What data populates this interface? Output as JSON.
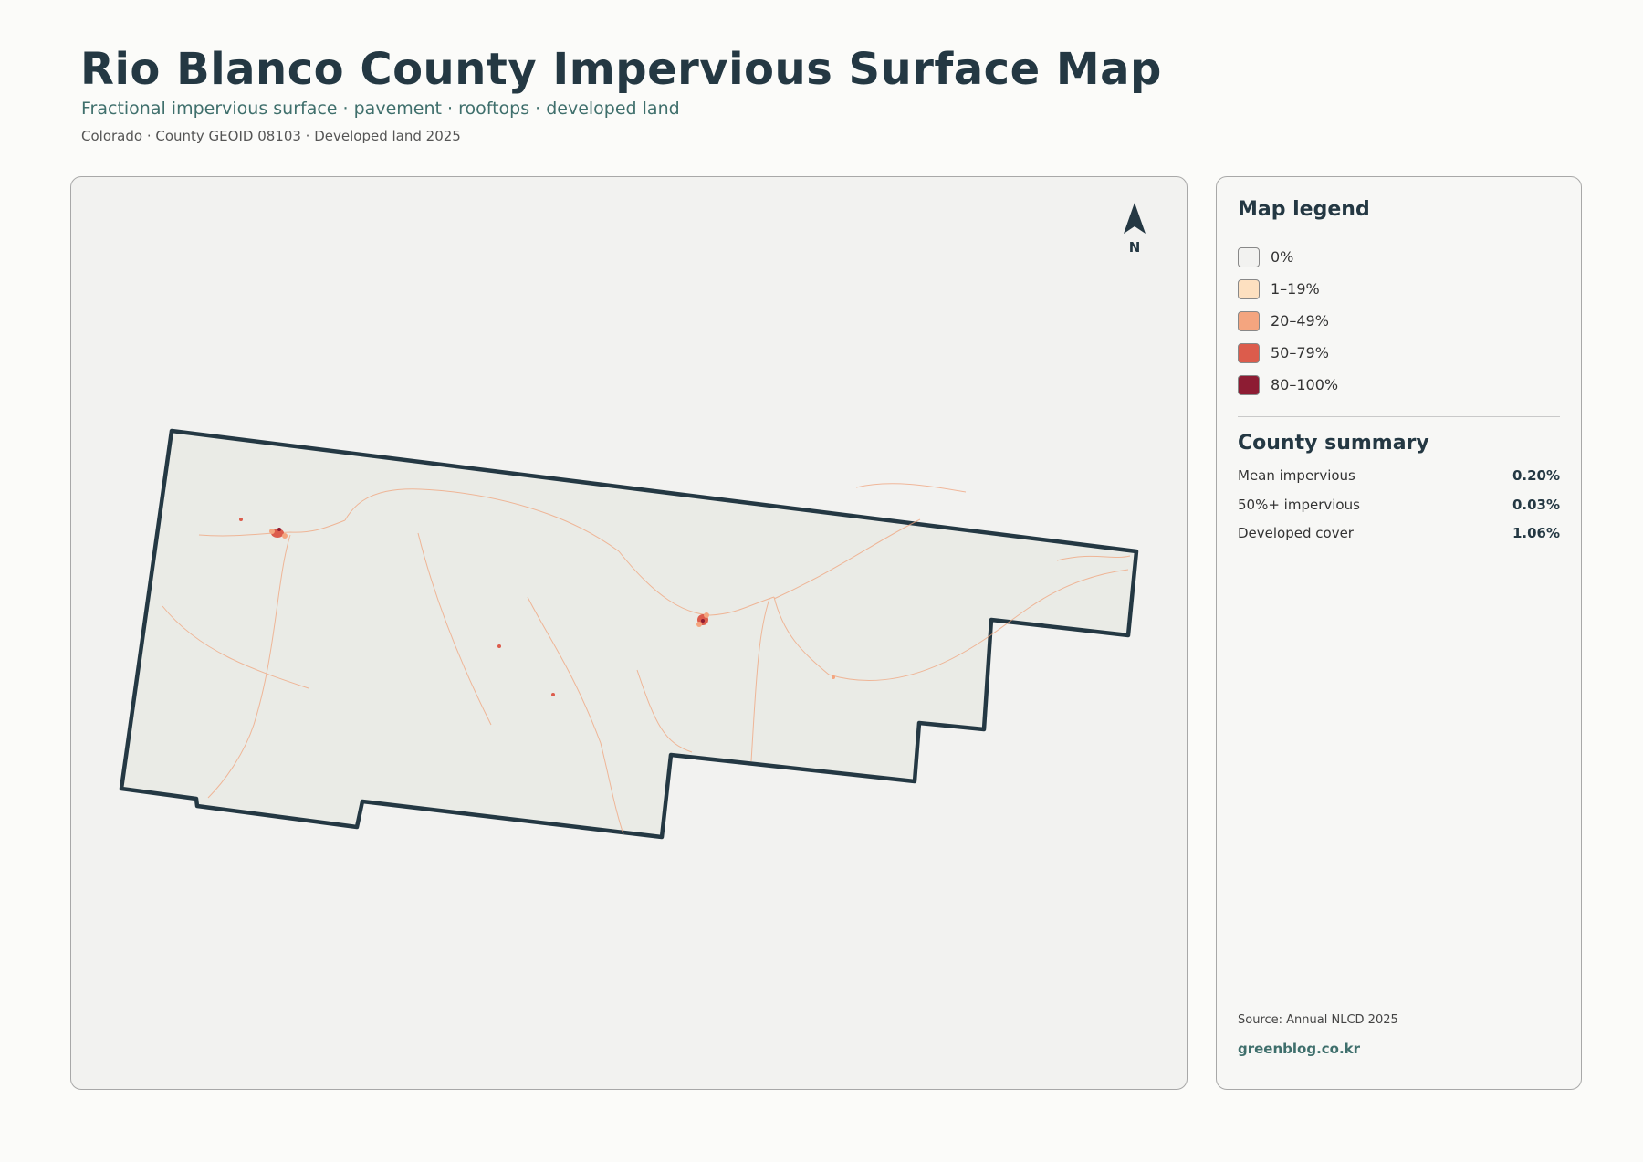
{
  "header": {
    "title": "Rio Blanco County Impervious Surface Map",
    "subtitle": "Fractional impervious surface · pavement · rooftops · developed land",
    "meta": "Colorado · County GEOID 08103 · Developed land 2025"
  },
  "map": {
    "north_label": "N",
    "county_fill": "#eaebe6",
    "boundary_color": "#243843",
    "road_color": "#f0a37c"
  },
  "legend": {
    "title": "Map legend",
    "items": [
      {
        "label": "0%",
        "color": "#f2f2f0"
      },
      {
        "label": "1–19%",
        "color": "#fde0c0"
      },
      {
        "label": "20–49%",
        "color": "#f4a57f"
      },
      {
        "label": "50–79%",
        "color": "#dc5c4c"
      },
      {
        "label": "80–100%",
        "color": "#8d1c33"
      }
    ]
  },
  "summary": {
    "title": "County summary",
    "rows": [
      {
        "label": "Mean impervious",
        "value": "0.20%"
      },
      {
        "label": "50%+ impervious",
        "value": "0.03%"
      },
      {
        "label": "Developed cover",
        "value": "1.06%"
      }
    ]
  },
  "footer": {
    "source": "Source: Annual NLCD 2025",
    "brand": "greenblog.co.kr"
  }
}
